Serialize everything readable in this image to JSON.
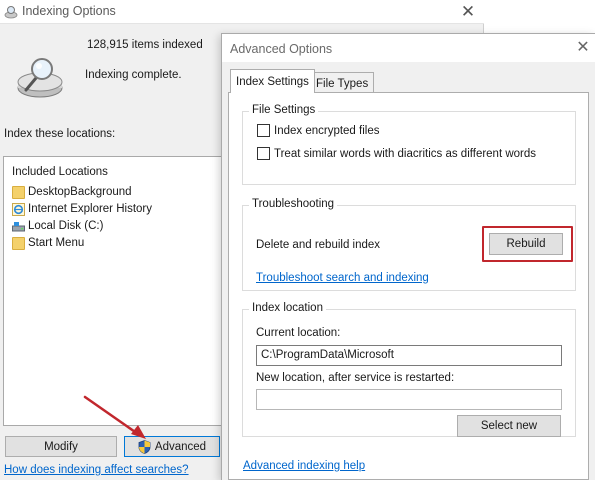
{
  "indexing_window": {
    "title": "Indexing Options",
    "close_glyph": "✕",
    "items_indexed": "128,915 items indexed",
    "status": "Indexing complete.",
    "index_these_label": "Index these locations:",
    "locations_header": "Included Locations",
    "locations": [
      {
        "label": "DesktopBackground",
        "icon": "folder-icon"
      },
      {
        "label": "Internet Explorer History",
        "icon": "internet-explorer-icon"
      },
      {
        "label": "Local Disk (C:)",
        "icon": "drive-icon"
      },
      {
        "label": "Start Menu",
        "icon": "folder-icon"
      }
    ],
    "modify_label": "Modify",
    "advanced_label": "Advanced",
    "help_link": "How does indexing affect searches?"
  },
  "advanced_window": {
    "title": "Advanced Options",
    "close_glyph": "✕",
    "tabs": [
      {
        "label": "Index Settings",
        "active": true
      },
      {
        "label": "File Types",
        "active": false
      }
    ],
    "file_settings": {
      "label": "File Settings",
      "options": [
        {
          "label": "Index encrypted files",
          "checked": false
        },
        {
          "label": "Treat similar words with diacritics as different words",
          "checked": false
        }
      ]
    },
    "troubleshooting": {
      "label": "Troubleshooting",
      "delete_rebuild_text": "Delete and rebuild index",
      "rebuild_label": "Rebuild",
      "troubleshoot_link": "Troubleshoot search and indexing"
    },
    "index_location": {
      "label": "Index location",
      "current_label": "Current location:",
      "current_value": "C:\\ProgramData\\Microsoft",
      "new_label": "New location, after service is restarted:",
      "new_value": "",
      "select_new_label": "Select new"
    },
    "advanced_help_link": "Advanced indexing help"
  },
  "colors": {
    "highlight": "#c1272d",
    "link": "#0066cc",
    "arrow": "#c1272d"
  }
}
